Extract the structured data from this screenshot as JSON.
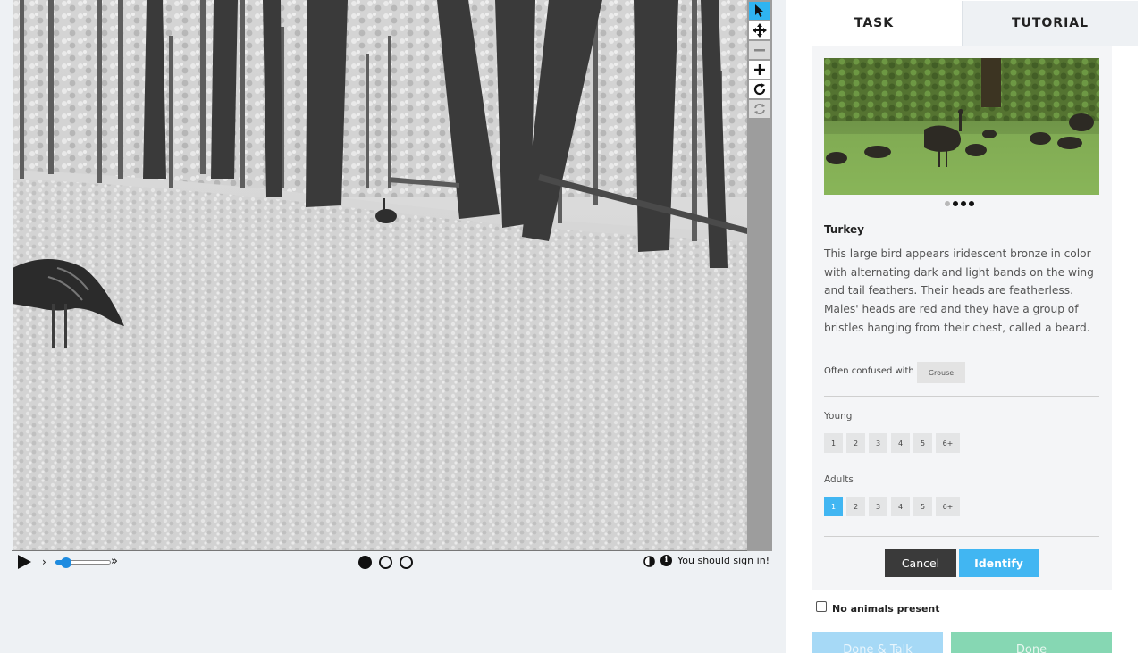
{
  "viewer": {
    "scene": "trail camera infrared photo of a forest with a turkey",
    "toolbar": {
      "tools": [
        {
          "name": "pointer",
          "icon": "cursor-arrow-icon",
          "active": true
        },
        {
          "name": "pan",
          "icon": "move-arrows-icon"
        },
        {
          "name": "zoom-out",
          "icon": "minus-icon",
          "disabled": true
        },
        {
          "name": "zoom-in",
          "icon": "plus-icon"
        },
        {
          "name": "rotate",
          "icon": "rotate-icon"
        },
        {
          "name": "reset",
          "icon": "reset-icon",
          "disabled": true
        }
      ]
    }
  },
  "controls": {
    "play_icon": "play-icon",
    "step_back_glyph": "›",
    "fast_forward_glyph": "»",
    "speed": 0.2,
    "frames": 3,
    "current_frame": 1,
    "sign_in_note": "You should sign in!"
  },
  "tabs": [
    {
      "label": "TASK",
      "active": true
    },
    {
      "label": "TUTORIAL",
      "active": false
    }
  ],
  "species": {
    "name": "Turkey",
    "description": "This large bird appears iridescent bronze in color with alternating dark and light bands on the wing and tail feathers. Their heads are featherless. Males' heads are red and they have a group of bristles hanging from their chest, called a beard.",
    "confused_label": "Often confused with",
    "confused_with": "Grouse",
    "carousel_count": 4,
    "carousel_index": 0
  },
  "young": {
    "label": "Young",
    "options": [
      "1",
      "2",
      "3",
      "4",
      "5",
      "6+"
    ],
    "selected": null
  },
  "adults": {
    "label": "Adults",
    "options": [
      "1",
      "2",
      "3",
      "4",
      "5",
      "6+"
    ],
    "selected": "1"
  },
  "actions": {
    "cancel": "Cancel",
    "identify": "Identify"
  },
  "no_animals_label": "No animals present",
  "footer": {
    "done_talk": "Done & Talk",
    "done": "Done"
  },
  "colors": {
    "accent": "#41b6f2",
    "done_green": "#86d7b3",
    "done_talk_blue": "#a6d9f6",
    "cancel_dark": "#3a3a3a",
    "background": "#eef1f4"
  }
}
